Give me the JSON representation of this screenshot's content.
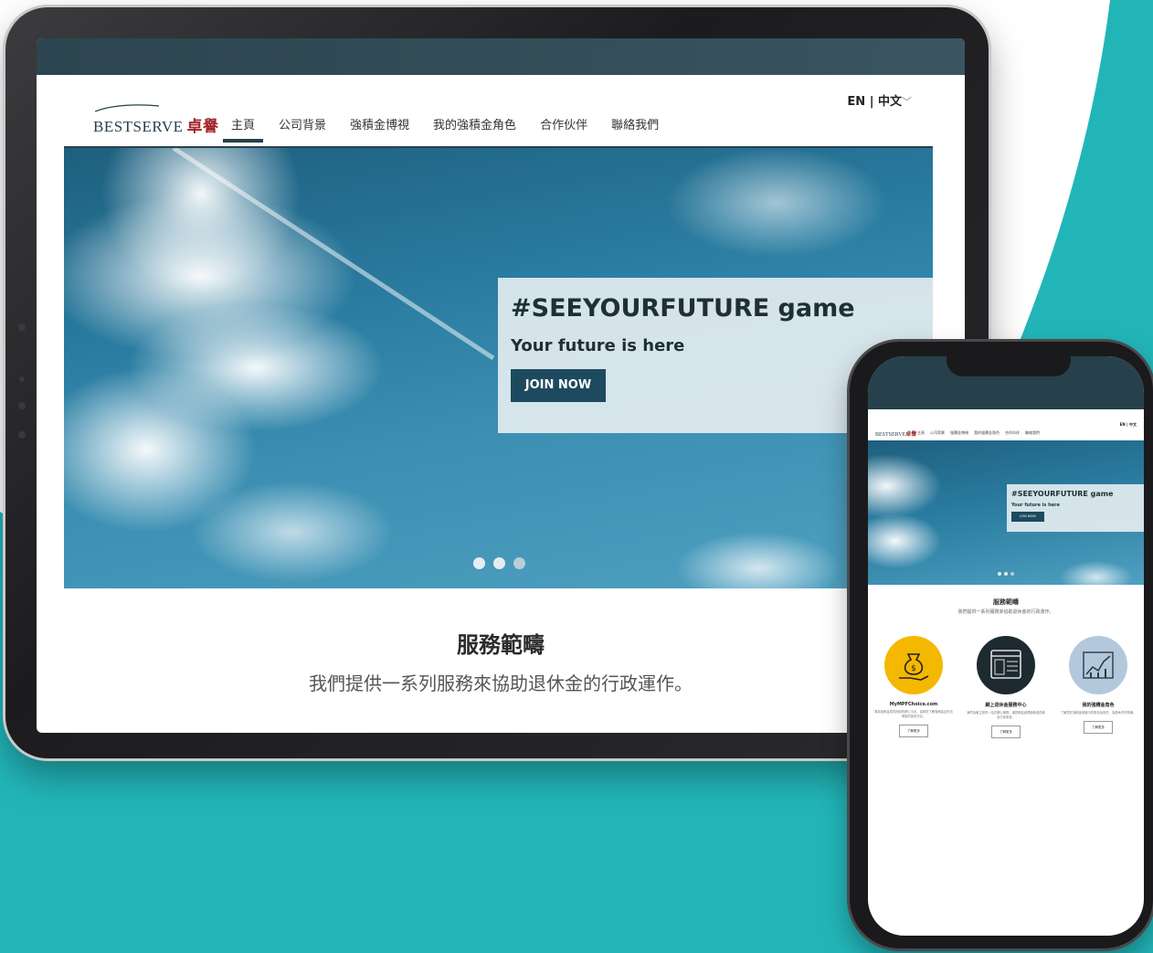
{
  "colors": {
    "teal_accent": "#22b5b8",
    "brand_dark": "#27404c",
    "button_dark": "#1d4a5e",
    "brand_red": "#a0262a"
  },
  "tablet": {
    "logo_en": "BESTSERVE",
    "logo_zh": "卓譽",
    "nav": [
      "主頁",
      "公司背景",
      "強積金博視",
      "我的強積金角色",
      "合作伙伴",
      "聯絡我們"
    ],
    "active_nav": "主頁",
    "lang": {
      "en": "EN",
      "separator": "|",
      "zh": "中文"
    },
    "hero": {
      "title": "#SEEYOURFUTURE game",
      "subtitle": "Your future is here",
      "button": "JOIN NOW",
      "slides": 3,
      "active_slide": 1
    },
    "section": {
      "title": "服務範疇",
      "subtitle": "我們提供一系列服務來協助退休金的行政運作。"
    }
  },
  "phone": {
    "logo_en": "BESTSERVE",
    "logo_zh": "卓譽",
    "nav": [
      "主頁",
      "公司背景",
      "強積金博視",
      "我的強積金角色",
      "合作伙伴",
      "聯絡我們"
    ],
    "lang": "EN | 中文",
    "hero": {
      "title": "#SEEYOURFUTURE game",
      "subtitle": "Your future is here",
      "button": "JOIN NOW"
    },
    "section": {
      "title": "服務範疇",
      "subtitle": "我們提供一系列服務來協助退休金的行政運作。"
    },
    "services": [
      {
        "name": "MyMPFChoice.com",
        "icon": "money-bag-hand-icon",
        "color": "#f5b800",
        "description": "專為強積金成員而設的網上平台，協助您了解強積金及作出明智的投資決定。",
        "more": "了解更多"
      },
      {
        "name": "網上退休金服務中心",
        "icon": "browser-window-icon",
        "color": "#1d2a30",
        "description": "我們為僱主提供一站式網上服務，讓您輕鬆處理強積金供款及行政事宜。",
        "more": "了解更多"
      },
      {
        "name": "我的強積金角色",
        "icon": "growth-chart-icon",
        "color": "#b3c8dc",
        "description": "了解您在強積金制度中的角色及責任，為退休作好準備。",
        "more": "了解更多"
      }
    ]
  }
}
